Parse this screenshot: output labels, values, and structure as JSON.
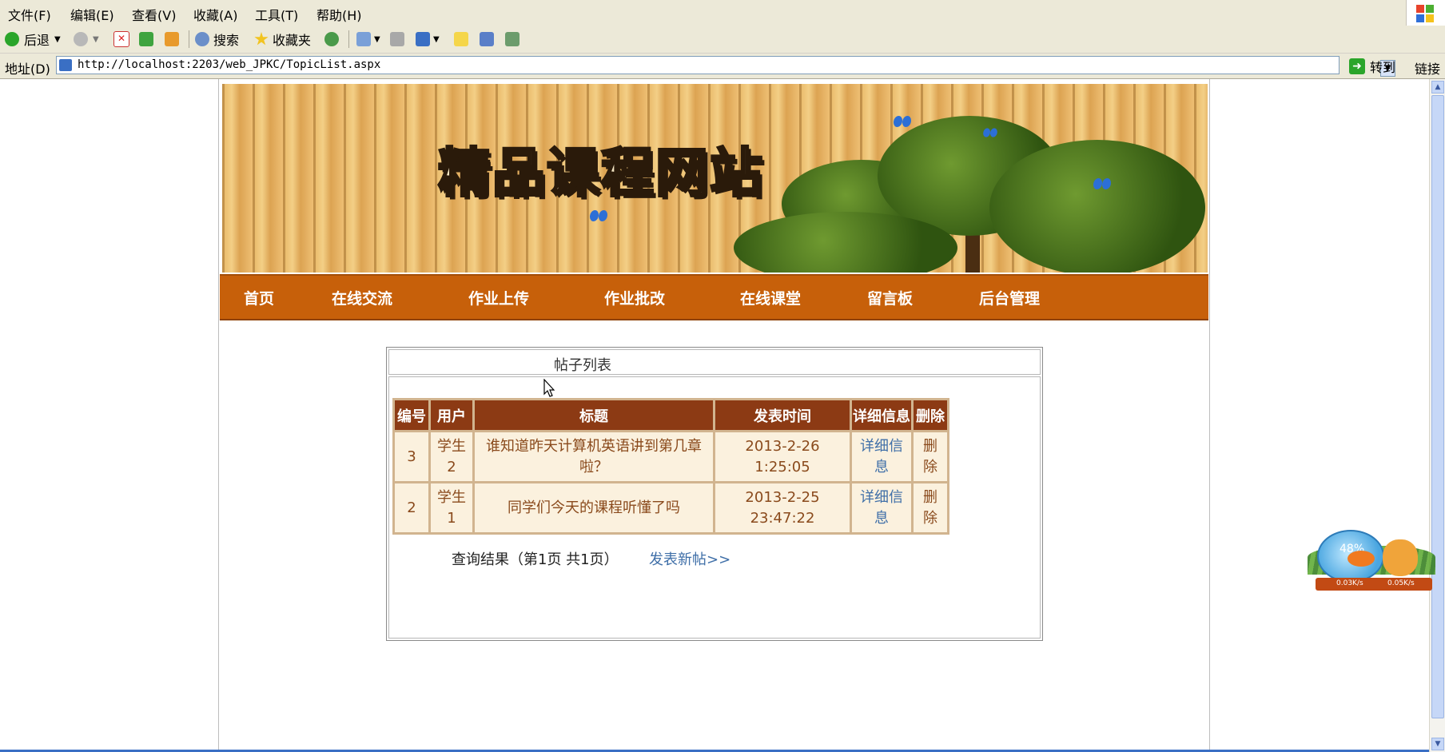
{
  "menu": {
    "items": [
      "文件(F)",
      "编辑(E)",
      "查看(V)",
      "收藏(A)",
      "工具(T)",
      "帮助(H)"
    ]
  },
  "toolbar": {
    "back_label": "后退",
    "search_label": "搜索",
    "favorites_label": "收藏夹"
  },
  "address": {
    "label": "地址(D)",
    "url": "http://localhost:2203/web_JPKC/TopicList.aspx",
    "go_label": "转到",
    "links_label": "链接"
  },
  "site": {
    "title": "精品课程网站"
  },
  "nav": {
    "items": [
      "首页",
      "在线交流",
      "作业上传",
      "作业批改",
      "在线课堂",
      "留言板",
      "后台管理"
    ]
  },
  "topic_list": {
    "heading": "帖子列表",
    "columns": [
      "编号",
      "用户",
      "标题",
      "发表时间",
      "详细信息",
      "删除"
    ],
    "rows": [
      {
        "id": "3",
        "user": "学生2",
        "title": "谁知道昨天计算机英语讲到第几章啦？",
        "time": "2013-2-26 1:25:05",
        "detail": "详细信息",
        "delete": "删除"
      },
      {
        "id": "2",
        "user": "学生1",
        "title": "同学们今天的课程听懂了吗",
        "time": "2013-2-25 23:47:22",
        "detail": "详细信息",
        "delete": "删除"
      }
    ],
    "pager": "查询结果（第1页 共1页）",
    "new_post": "发表新帖>>"
  },
  "widget": {
    "percent": "48%",
    "upload": "0.03K/s",
    "download": "0.05K/s"
  },
  "colors": {
    "nav_bg": "#c7600a",
    "header_cell": "#8c3a14",
    "body_cell": "#fbf1de",
    "link": "#3f6fa8"
  }
}
